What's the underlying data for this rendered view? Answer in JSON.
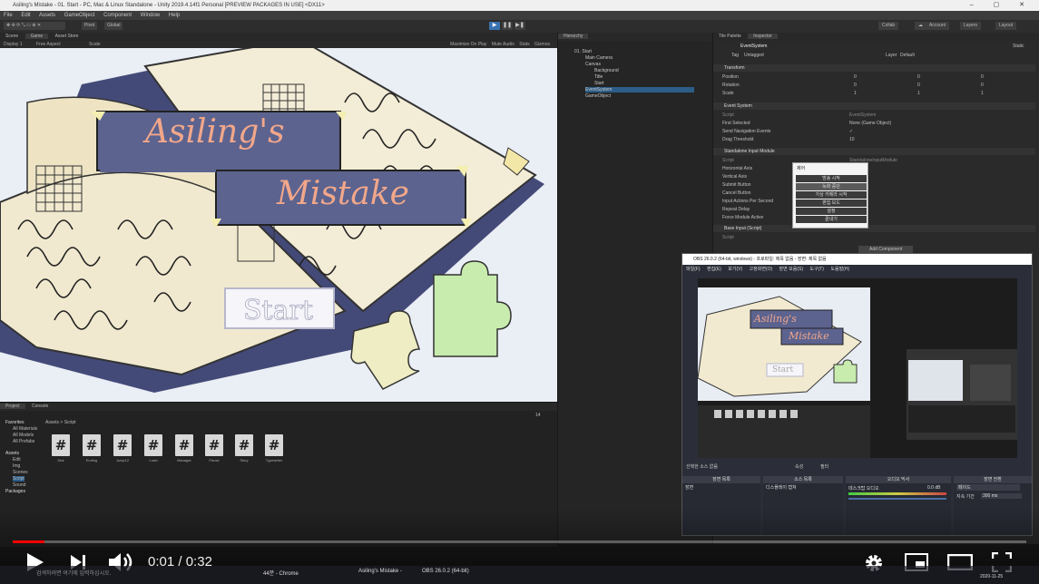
{
  "unity": {
    "window_title": "Asiling's Mistake - 01. Start - PC, Mac & Linux Standalone - Unity 2019.4.14f1 Personal [PREVIEW PACKAGES IN USE] <DX11>",
    "menu": [
      "File",
      "Edit",
      "Assets",
      "GameObject",
      "Component",
      "Window",
      "Help"
    ],
    "toolbar": {
      "pivot": "Pivot",
      "global": "Global",
      "account": "Account",
      "layers": "Layers",
      "layout": "Layout",
      "collab": "Collab"
    },
    "scene_tabs": [
      "Scene",
      "Game",
      "Asset Store"
    ],
    "game_bar": {
      "display": "Display 1",
      "aspect": "Free Aspect",
      "scale": "Scale",
      "right": [
        "Maximize On Play",
        "Mute Audio",
        "Stats",
        "Gizmos"
      ]
    },
    "game_view": {
      "title_line1": "Asiling's",
      "title_line2": "Mistake",
      "start_button": "Start"
    },
    "hierarchy": {
      "tab": "Hierarchy",
      "items": [
        "01. Start",
        "Main Camera",
        "Canvas",
        "Background",
        "Title",
        "Start",
        "EventSystem",
        "GameObject"
      ]
    },
    "inspector": {
      "tabs": [
        "Tile Palette",
        "Inspector"
      ],
      "object_name": "EventSystem",
      "static_label": "Static",
      "tag_label": "Tag",
      "tag_value": "Untagged",
      "layer_label": "Layer",
      "layer_value": "Default",
      "transform": {
        "header": "Transform",
        "rows": [
          {
            "label": "Position",
            "x": "0",
            "y": "0",
            "z": "0"
          },
          {
            "label": "Rotation",
            "x": "0",
            "y": "0",
            "z": "0"
          },
          {
            "label": "Scale",
            "x": "1",
            "y": "1",
            "z": "1"
          }
        ]
      },
      "event_system": {
        "header": "Event System",
        "rows": [
          {
            "label": "Script",
            "value": "EventSystem"
          },
          {
            "label": "First Selected",
            "value": "None (Game Object)"
          },
          {
            "label": "Send Navigation Events",
            "value": "✓"
          },
          {
            "label": "Drag Threshold",
            "value": "10"
          }
        ]
      },
      "input_module": {
        "header": "Standalone Input Module",
        "rows": [
          "Script",
          "Horizontal Axis",
          "Vertical Axis",
          "Submit Button",
          "Cancel Button",
          "Input Actions Per Second",
          "Repeat Delay",
          "Force Module Active"
        ],
        "script_value": "StandaloneInputModule"
      },
      "base_input": {
        "header": "Base Input (Script)",
        "script_label": "Script"
      },
      "add_component": "Add Component"
    },
    "context_menu": {
      "title": "제어",
      "items": [
        "방송 시작",
        "녹화 중단",
        "가상 카메라 시작",
        "편집 모드",
        "설정",
        "끝내기"
      ]
    },
    "project": {
      "tabs": [
        "Project",
        "Console"
      ],
      "breadcrumb": "Assets > Script",
      "tree": [
        "Favorites",
        "All Materials",
        "All Models",
        "All Prefabs",
        "Assets",
        "Edit",
        "Img",
        "Scenes",
        "Script",
        "Sound",
        "Packages"
      ],
      "scripts": [
        "Dial",
        "Ending",
        "Jump12",
        "Load",
        "Manager",
        "Pause",
        "Story",
        "Typewriter"
      ],
      "count": "14"
    }
  },
  "obs": {
    "title": "OBS 26.0.2 (64-bit, windows) - 프로파일: 제목 없음 - 장면: 제목 없음",
    "menu": [
      "파일(F)",
      "편집(E)",
      "보기(V)",
      "고정화면(O)",
      "장면 모음(S)",
      "도구(T)",
      "도움말(H)"
    ],
    "docks": [
      "장면 목록",
      "소스 목록",
      "오디오 믹서",
      "장면 전환"
    ],
    "sources": "선택한 소스 없음",
    "properties": "속성",
    "filters": "필터",
    "scene_item": "장면",
    "source_item": "디스플레이 캡쳐",
    "mixer_label": "데스크탑 오디오",
    "mixer_db": "0.0 dB",
    "transition": "페이드",
    "duration_label": "지속 기간",
    "duration_value": "300 ms",
    "preview_title1": "Asiling's",
    "preview_title2": "Mistake",
    "preview_start": "Start"
  },
  "player": {
    "current_time": "0:01",
    "duration": "0:32",
    "time_separator": " / ",
    "progress_fraction": 0.031
  },
  "taskbar": {
    "search": "검색하려면 여기에 입력하십시오.",
    "items": [
      "44분 - Chrome",
      "Asiling's Mistake -",
      "OBS 26.0.2 (64-bit)"
    ],
    "clock": "2020-11-25"
  }
}
